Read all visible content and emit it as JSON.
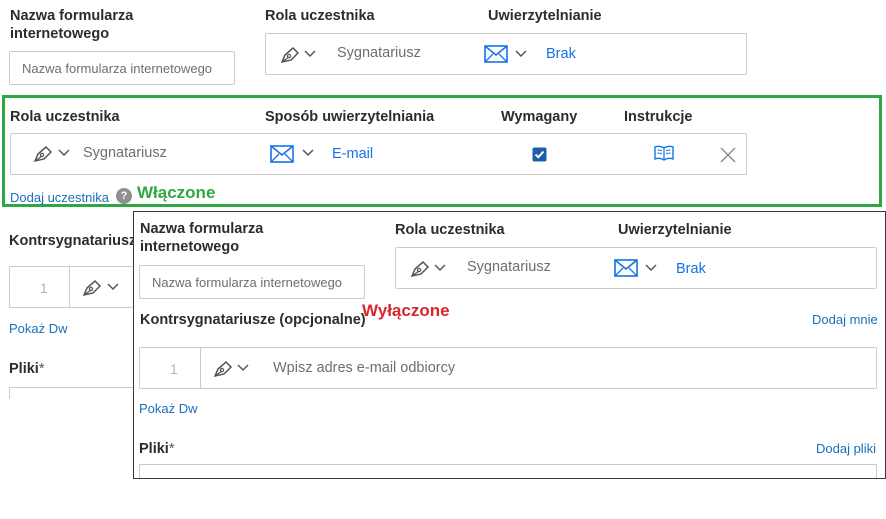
{
  "bg_form": {
    "form_name_label_line1": "Nazwa formularza",
    "form_name_label_line2": "internetowego",
    "form_name_placeholder": "Nazwa formularza internetowego",
    "role_label": "Rola uczestnika",
    "auth_label": "Uwierzytelnianie",
    "role_value": "Sygnatariusz",
    "auth_value": "Brak",
    "cosigner_label": "Kontrsygnatariusz",
    "cosigner_index": "1",
    "show_cc": "Pokaż Dw",
    "files_label": "Pliki",
    "required_mark": "*"
  },
  "enabled_panel": {
    "role_header": "Rola uczestnika",
    "auth_method_header": "Sposób uwierzytelniania",
    "required_header": "Wymagany",
    "instructions_header": "Instrukcje",
    "role_value": "Sygnatariusz",
    "auth_value": "E-mail",
    "required_checked": true,
    "add_participant": "Dodaj uczestnika",
    "help_glyph": "?",
    "status_label": "Włączone"
  },
  "disabled_panel": {
    "form_name_label_line1": "Nazwa formularza",
    "form_name_label_line2": "internetowego",
    "form_name_placeholder": "Nazwa formularza internetowego",
    "role_label": "Rola uczestnika",
    "auth_label": "Uwierzytelnianie",
    "role_value": "Sygnatariusz",
    "auth_value": "Brak",
    "cosigners_label": "Kontrsygnatariusze (opcjonalne)",
    "status_label": "Wyłączone",
    "add_me": "Dodaj mnie",
    "cosigner_index": "1",
    "email_placeholder": "Wpisz adres e-mail odbiorcy",
    "show_cc": "Pokaż Dw",
    "files_label": "Pliki",
    "required_mark": "*",
    "add_files": "Dodaj pliki"
  },
  "colors": {
    "enabled_green": "#2fa745",
    "disabled_red": "#d7262c",
    "link_blue": "#1473e6",
    "checkbox_blue": "#1a5fa8"
  },
  "icons": [
    "pen-signature-icon",
    "chevron-down-icon",
    "envelope-icon",
    "book-icon",
    "close-icon",
    "help-icon",
    "checkbox-checked-icon"
  ]
}
